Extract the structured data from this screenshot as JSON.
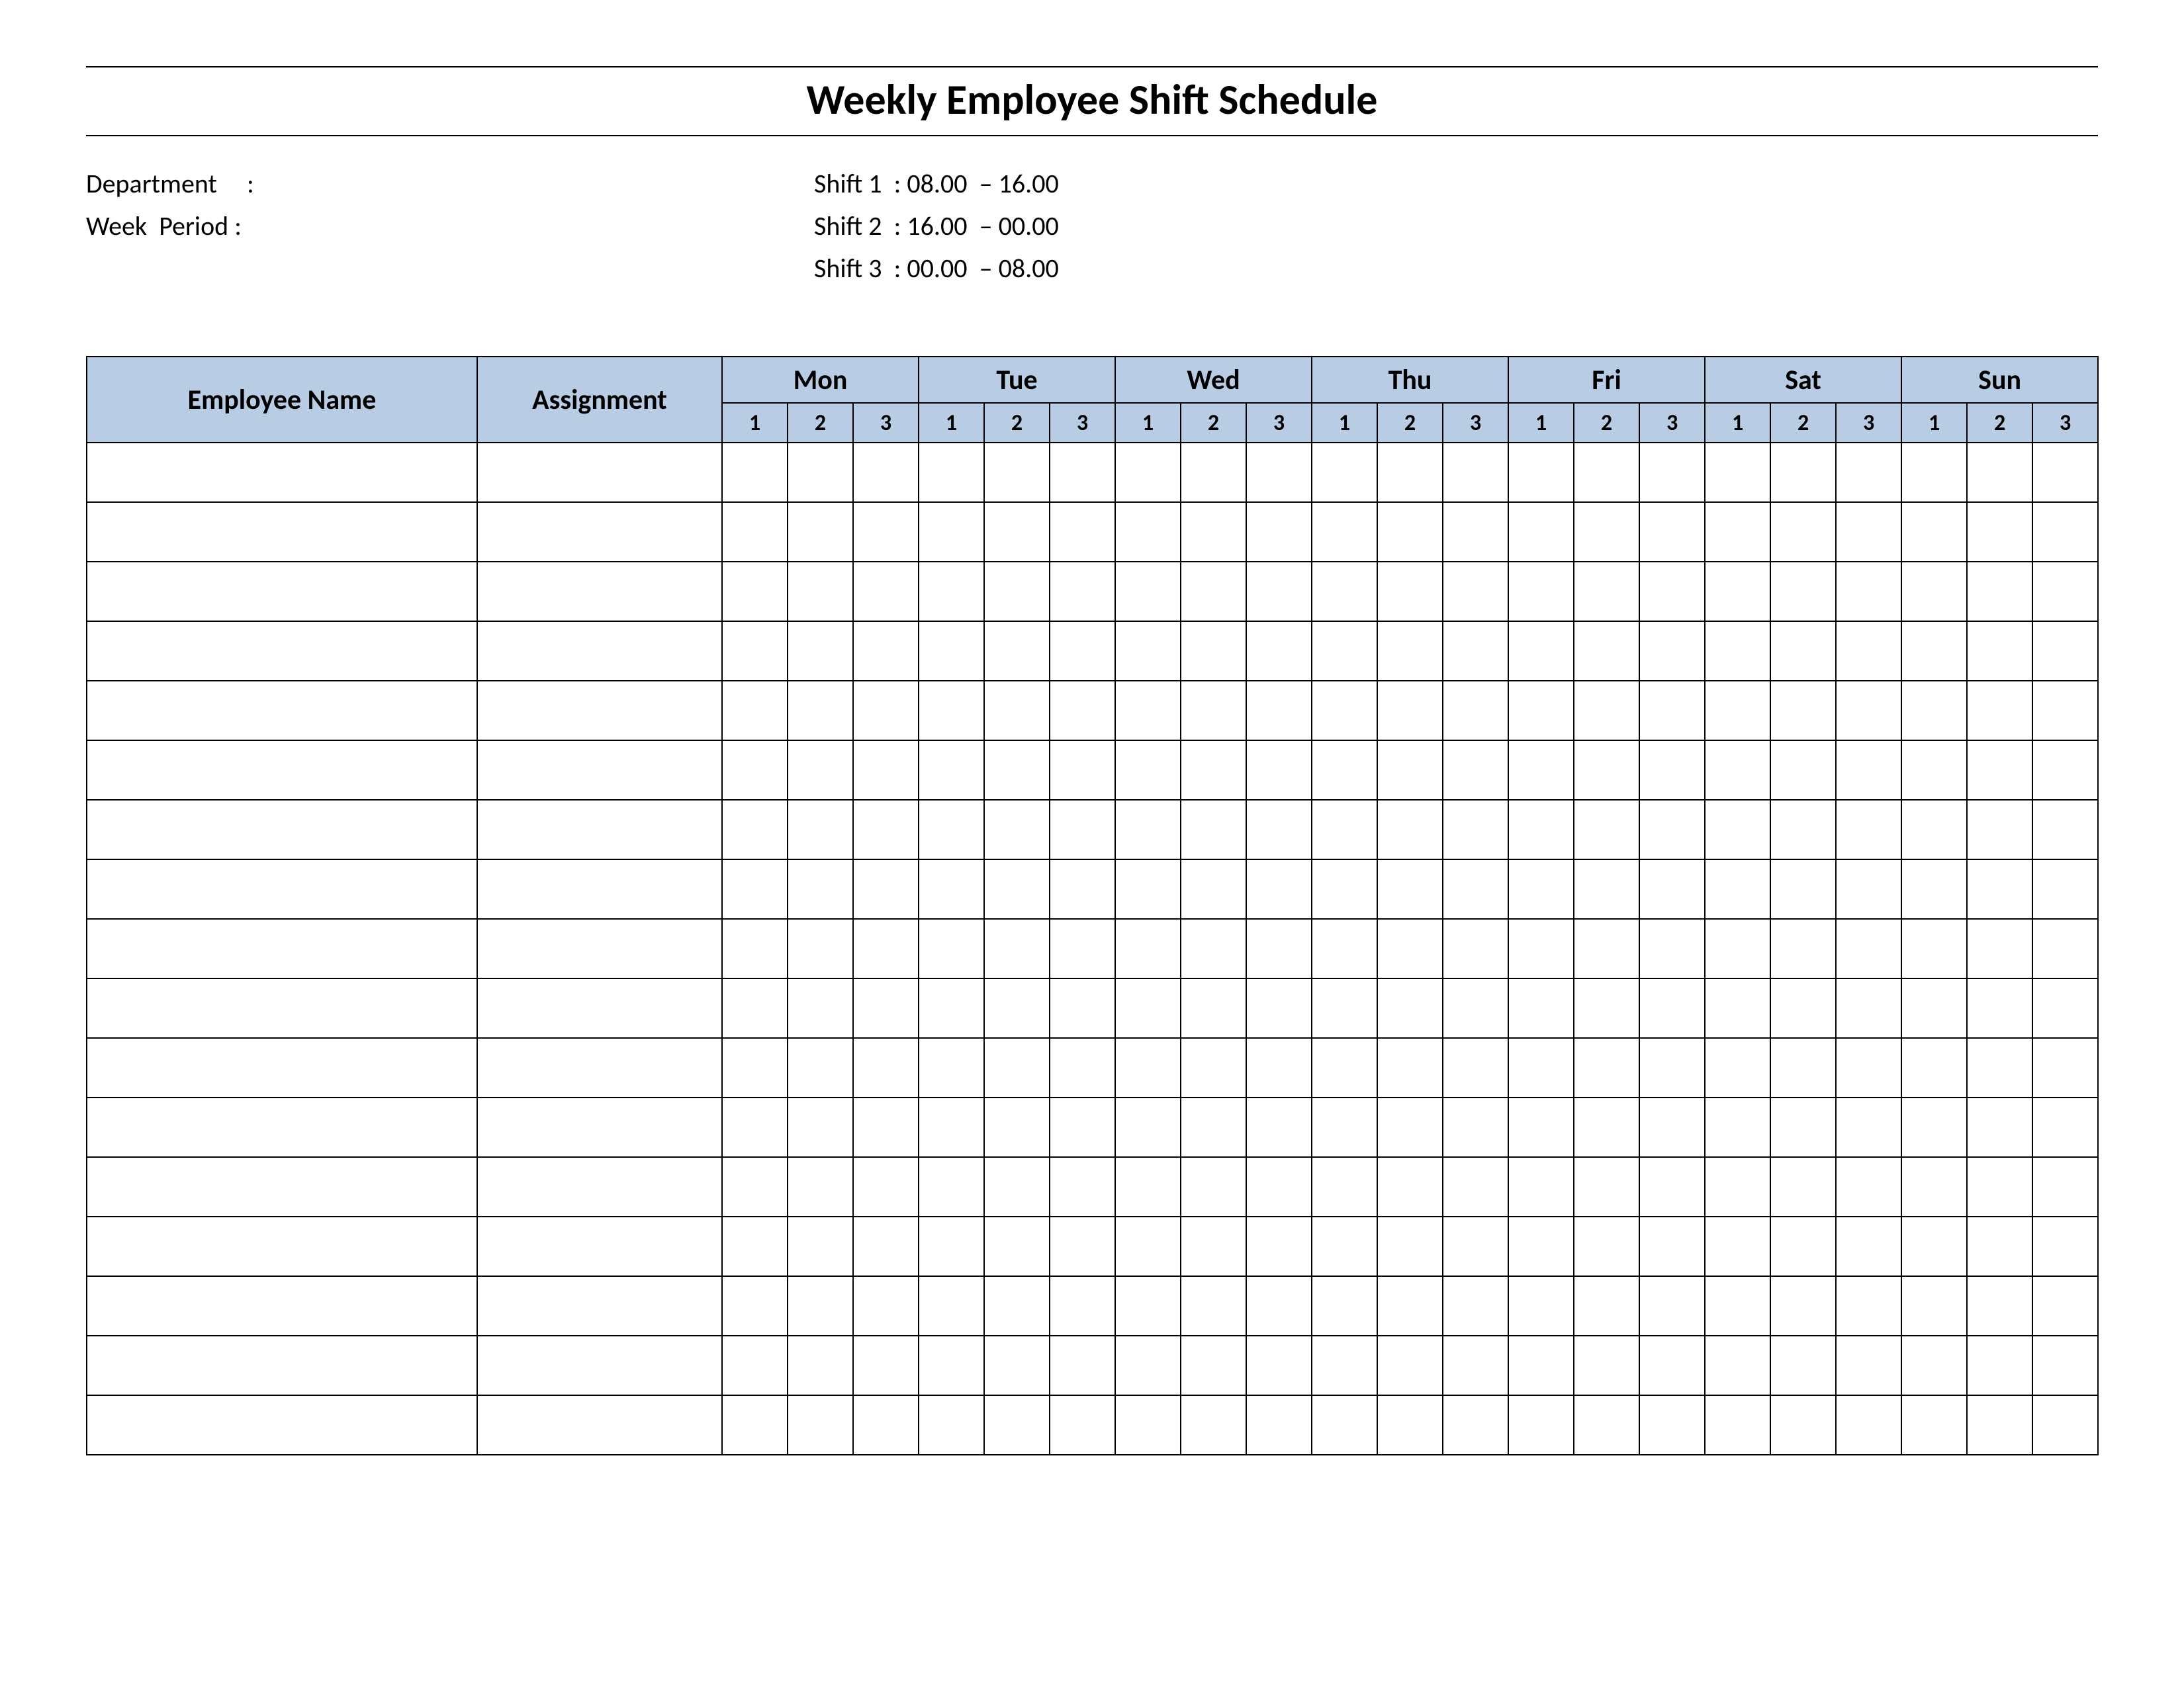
{
  "title": "Weekly Employee Shift Schedule",
  "meta": {
    "department_label": "Department     :",
    "week_period_label": "Week  Period :",
    "shift1": "Shift 1  : 08.00  – 16.00",
    "shift2": "Shift 2  : 16.00  – 00.00",
    "shift3": "Shift 3  : 00.00  – 08.00"
  },
  "headers": {
    "employee_name": "Employee Name",
    "assignment": "Assignment",
    "days": [
      "Mon",
      "Tue",
      "Wed",
      "Thu",
      "Fri",
      "Sat",
      "Sun"
    ],
    "shift_nums": [
      "1",
      "2",
      "3"
    ]
  },
  "row_count": 17
}
